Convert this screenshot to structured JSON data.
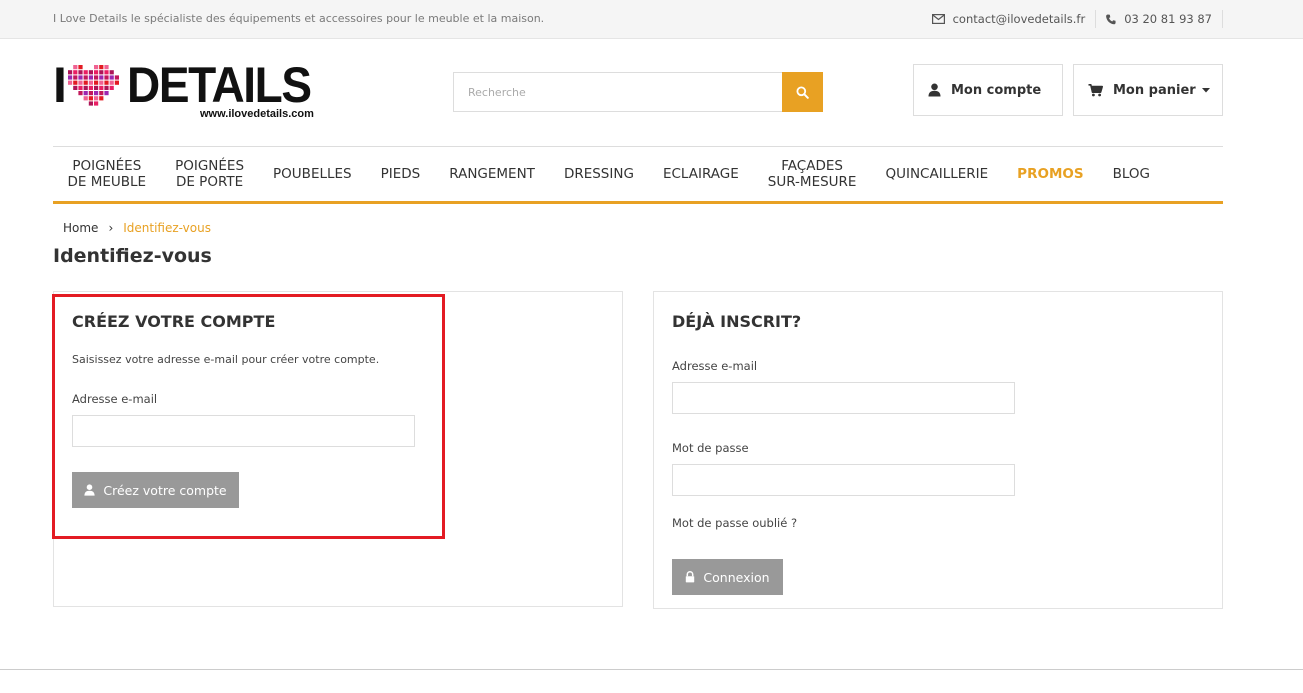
{
  "topbar": {
    "tagline": "I Love Details le spécialiste des équipements et accessoires pour le meuble et la maison.",
    "email": "contact@ilovedetails.fr",
    "phone": "03 20 81 93 87",
    "email_icon": "envelope-icon",
    "phone_icon": "phone-icon"
  },
  "logo": {
    "letter": "I",
    "word": "DETAILS",
    "url": "www.ilovedetails.com",
    "heart_colors": [
      "#e31b23",
      "#c2185b",
      "#e91e63",
      "#f06292",
      "#9c27b0",
      "#ad1457"
    ]
  },
  "search": {
    "placeholder": "Recherche",
    "button_icon": "search-icon",
    "button_color": "#e8a123"
  },
  "header": {
    "account_label": "Mon compte",
    "cart_label": "Mon panier"
  },
  "nav": {
    "items": [
      {
        "line1": "POIGNÉES",
        "line2": "DE MEUBLE"
      },
      {
        "line1": "POIGNÉES",
        "line2": "DE PORTE"
      },
      {
        "line1": "POUBELLES",
        "line2": ""
      },
      {
        "line1": "PIEDS",
        "line2": ""
      },
      {
        "line1": "RANGEMENT",
        "line2": ""
      },
      {
        "line1": "DRESSING",
        "line2": ""
      },
      {
        "line1": "ECLAIRAGE",
        "line2": ""
      },
      {
        "line1": "FAÇADES",
        "line2": "SUR-MESURE"
      },
      {
        "line1": "QUINCAILLERIE",
        "line2": ""
      },
      {
        "line1": "PROMOS",
        "line2": ""
      },
      {
        "line1": "BLOG",
        "line2": ""
      }
    ],
    "accent": "#e8a123"
  },
  "breadcrumb": {
    "home": "Home",
    "separator": "›",
    "current": "Identifiez-vous"
  },
  "page": {
    "title": "Identifiez-vous"
  },
  "create": {
    "title": "CRÉEZ VOTRE COMPTE",
    "description": "Saisissez votre adresse e-mail pour créer votre compte.",
    "email_label": "Adresse e-mail",
    "email_value": "",
    "button_label": "Créez votre compte",
    "highlight_color": "#e31b23"
  },
  "login": {
    "title": "DÉJÀ INSCRIT?",
    "email_label": "Adresse e-mail",
    "email_value": "",
    "password_label": "Mot de passe",
    "password_value": "",
    "forgot_label": "Mot de passe oublié ?",
    "button_label": "Connexion"
  }
}
